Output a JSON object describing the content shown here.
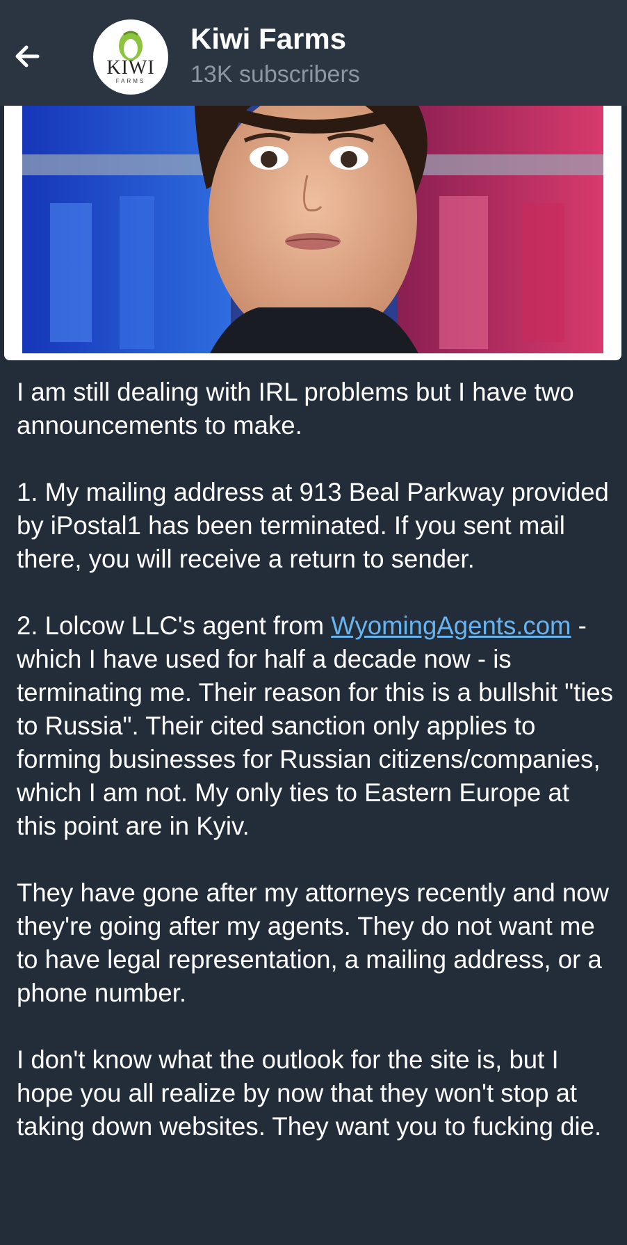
{
  "header": {
    "channel_name": "Kiwi Farms",
    "subscribers": "13K subscribers",
    "avatar_text": "KIWI",
    "avatar_subtext": "FARMS",
    "back_icon": "arrow-left-icon"
  },
  "post": {
    "media_icon": "photo",
    "paragraphs": {
      "p1": "I am still dealing with IRL problems but I have two announcements to make.",
      "p2": "1. My mailing address at 913 Beal Parkway provided by iPostal1 has been terminated. If you sent mail there, you will receive a return to sender.",
      "p3_before": "2. Lolcow LLC's agent from ",
      "p3_link": "WyomingAgents.com",
      "p3_after": " - which I have used for half a decade now - is terminating me. Their reason for this is a bullshit \"ties to Russia\". Their cited sanction only applies to forming businesses for Russian citizens/companies, which I am not. My only ties to Eastern Europe at this point are in Kyiv.",
      "p4": "They have gone after my attorneys recently and now they're going after my agents. They do not want me to have legal representation, a mailing address, or a phone number.",
      "p5": "I don't know what the outlook for the site is, but I hope you all realize by now that they won't stop at taking down websites. They want you to fucking die."
    }
  },
  "colors": {
    "background": "#232d39",
    "header": "#2b3542",
    "link": "#67b4f0",
    "subtitle": "#8d97a3"
  }
}
